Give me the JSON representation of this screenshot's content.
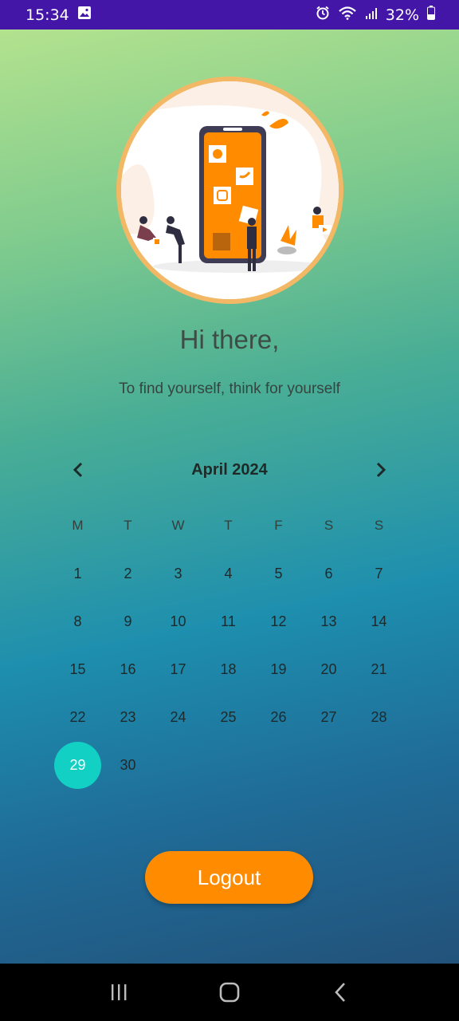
{
  "status_bar": {
    "time": "15:34",
    "battery": "32%",
    "icons": [
      "image-icon",
      "alarm-icon",
      "wifi-icon",
      "signal-icon",
      "battery-icon"
    ]
  },
  "greeting": "Hi there,",
  "tagline": "To find yourself, think for yourself",
  "calendar": {
    "month_label": "April 2024",
    "weekdays": [
      "M",
      "T",
      "W",
      "T",
      "F",
      "S",
      "S"
    ],
    "weeks": [
      [
        "1",
        "2",
        "3",
        "4",
        "5",
        "6",
        "7"
      ],
      [
        "8",
        "9",
        "10",
        "11",
        "12",
        "13",
        "14"
      ],
      [
        "15",
        "16",
        "17",
        "18",
        "19",
        "20",
        "21"
      ],
      [
        "22",
        "23",
        "24",
        "25",
        "26",
        "27",
        "28"
      ],
      [
        "29",
        "30",
        "",
        "",
        "",
        "",
        ""
      ]
    ],
    "selected_day": "29",
    "selected_color": "#12d0c4"
  },
  "logout_label": "Logout",
  "colors": {
    "accent_button": "#ff8c00",
    "status_bar": "#4416a8",
    "hero_border": "#f2b865"
  },
  "nav_bar": {
    "icons": [
      "recent-apps-icon",
      "home-icon",
      "back-icon"
    ]
  }
}
